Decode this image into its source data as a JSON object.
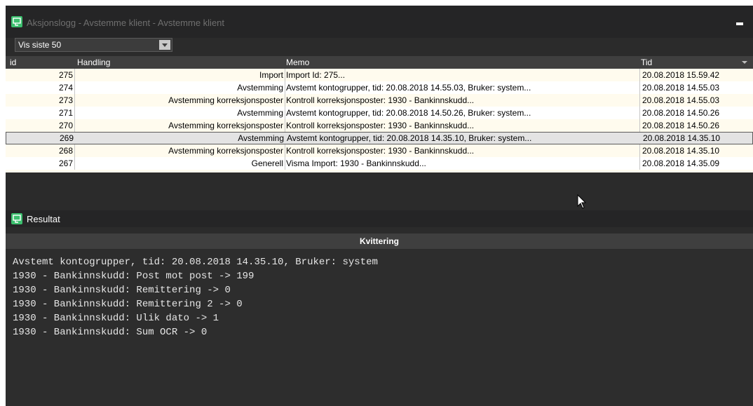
{
  "window": {
    "title": "Aksjonslogg - Avstemme klient - Avstemme klient"
  },
  "filter": {
    "value": "Vis siste 50"
  },
  "grid": {
    "headers": {
      "id": "id",
      "handling": "Handling",
      "memo": "Memo",
      "tid": "Tid"
    },
    "rows": [
      {
        "id": "275",
        "handling": "Import",
        "memo": "Import Id: 275...",
        "tid": "20.08.2018 15.59.42"
      },
      {
        "id": "274",
        "handling": "Avstemming",
        "memo": "Avstemt kontogrupper, tid: 20.08.2018 14.55.03, Bruker: system...",
        "tid": "20.08.2018 14.55.03"
      },
      {
        "id": "273",
        "handling": "Avstemming korreksjonsposter",
        "memo": "Kontroll korreksjonsposter: 1930 - Bankinnskudd...",
        "tid": "20.08.2018 14.55.03"
      },
      {
        "id": "271",
        "handling": "Avstemming",
        "memo": "Avstemt kontogrupper, tid: 20.08.2018 14.50.26, Bruker: system...",
        "tid": "20.08.2018 14.50.26"
      },
      {
        "id": "270",
        "handling": "Avstemming korreksjonsposter",
        "memo": "Kontroll korreksjonsposter: 1930 - Bankinnskudd...",
        "tid": "20.08.2018 14.50.26"
      },
      {
        "id": "269",
        "handling": "Avstemming",
        "memo": "Avstemt kontogrupper, tid: 20.08.2018 14.35.10, Bruker: system...",
        "tid": "20.08.2018 14.35.10"
      },
      {
        "id": "268",
        "handling": "Avstemming korreksjonsposter",
        "memo": "Kontroll korreksjonsposter: 1930 - Bankinnskudd...",
        "tid": "20.08.2018 14.35.10"
      },
      {
        "id": "267",
        "handling": "Generell",
        "memo": "Visma Import: 1930 - Bankinnskudd...",
        "tid": "20.08.2018 14.35.09"
      }
    ]
  },
  "result": {
    "title": "Resultat",
    "column": "Kvittering",
    "lines": [
      "Avstemt kontogrupper, tid: 20.08.2018 14.35.10, Bruker: system",
      "1930 - Bankinnskudd: Post mot post -> 199",
      "1930 - Bankinnskudd: Remittering -> 0",
      "1930 - Bankinnskudd: Remittering 2 -> 0",
      "1930 - Bankinnskudd: Ulik dato -> 1",
      "1930 - Bankinnskudd: Sum OCR -> 0"
    ]
  },
  "colors": {
    "accent_icon": "#3cbf6e",
    "row_alt": "#fffbee",
    "row_selected": "#e3e3e3"
  }
}
